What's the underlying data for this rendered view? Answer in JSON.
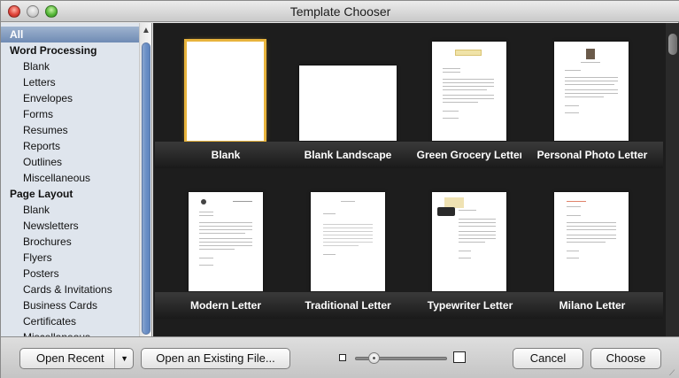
{
  "window": {
    "title": "Template Chooser"
  },
  "sidebar": {
    "items": [
      {
        "label": "All",
        "kind": "selected"
      },
      {
        "label": "Word Processing",
        "kind": "group"
      },
      {
        "label": "Blank",
        "kind": "sub"
      },
      {
        "label": "Letters",
        "kind": "sub"
      },
      {
        "label": "Envelopes",
        "kind": "sub"
      },
      {
        "label": "Forms",
        "kind": "sub"
      },
      {
        "label": "Resumes",
        "kind": "sub"
      },
      {
        "label": "Reports",
        "kind": "sub"
      },
      {
        "label": "Outlines",
        "kind": "sub"
      },
      {
        "label": "Miscellaneous",
        "kind": "sub"
      },
      {
        "label": "Page Layout",
        "kind": "group"
      },
      {
        "label": "Blank",
        "kind": "sub"
      },
      {
        "label": "Newsletters",
        "kind": "sub"
      },
      {
        "label": "Brochures",
        "kind": "sub"
      },
      {
        "label": "Flyers",
        "kind": "sub"
      },
      {
        "label": "Posters",
        "kind": "sub"
      },
      {
        "label": "Cards & Invitations",
        "kind": "sub"
      },
      {
        "label": "Business Cards",
        "kind": "sub"
      },
      {
        "label": "Certificates",
        "kind": "sub"
      },
      {
        "label": "Miscellaneous",
        "kind": "sub"
      }
    ]
  },
  "templates": [
    {
      "label": "Blank"
    },
    {
      "label": "Blank Landscape"
    },
    {
      "label": "Green Grocery Letter"
    },
    {
      "label": "Personal Photo Letter"
    },
    {
      "label": "Modern Letter"
    },
    {
      "label": "Traditional Letter"
    },
    {
      "label": "Typewriter Letter"
    },
    {
      "label": "Milano Letter"
    }
  ],
  "selected_template": "Blank",
  "footer": {
    "open_recent": "Open Recent",
    "open_existing": "Open an Existing File...",
    "cancel": "Cancel",
    "choose": "Choose",
    "zoom_level": 0.2
  },
  "colors": {
    "selection_ring": "#e8b43d",
    "sidebar_selection": "#6f8bb4",
    "gallery_bg": "#1d1d1d"
  }
}
